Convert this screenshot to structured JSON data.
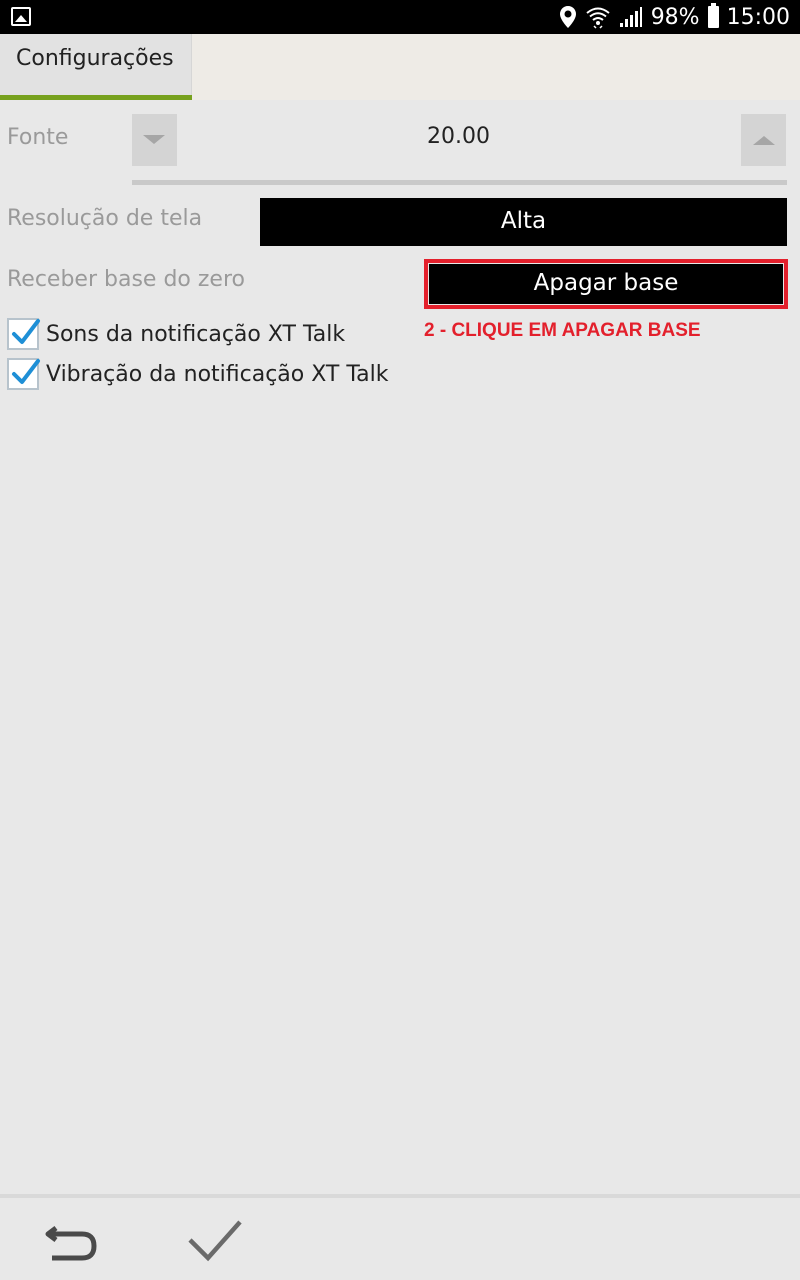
{
  "status_bar": {
    "battery_percent": "98%",
    "time": "15:00",
    "icons": [
      "gallery-icon",
      "location-icon",
      "wifi-icon",
      "signal-icon",
      "battery-icon"
    ]
  },
  "tabs": [
    {
      "label": "Configurações",
      "active": true
    }
  ],
  "settings": {
    "font": {
      "label": "Fonte",
      "value": "20.00"
    },
    "resolution": {
      "label": "Resolução de tela",
      "value": "Alta"
    },
    "reset_base": {
      "label": "Receber base do zero",
      "button_label": "Apagar base"
    },
    "annotation": "2 - CLIQUE EM APAGAR BASE",
    "checkboxes": [
      {
        "label": "Sons da notificação XT Talk",
        "checked": true
      },
      {
        "label": "Vibração da notificação XT Talk",
        "checked": true
      }
    ]
  },
  "bottom_bar": {
    "actions": [
      "back-icon",
      "confirm-check-icon"
    ]
  },
  "colors": {
    "accent": "#77a11e",
    "highlight": "#e3202c",
    "checkmark": "#1e8fd6"
  }
}
